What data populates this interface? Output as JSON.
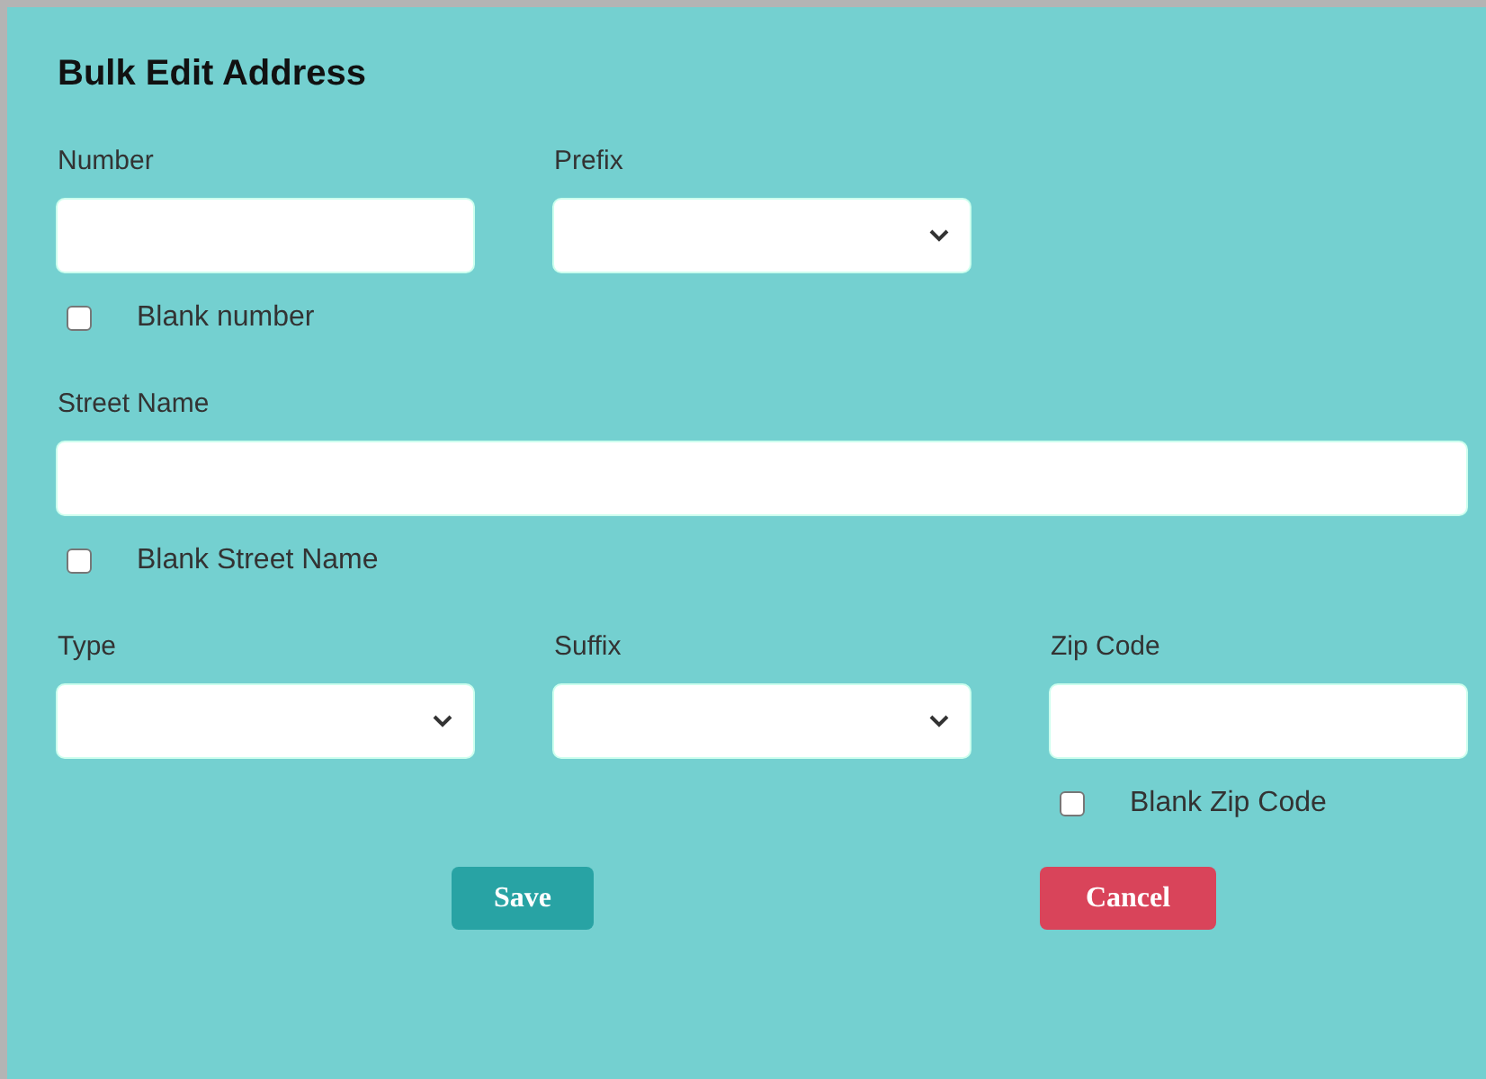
{
  "title": "Bulk Edit Address",
  "rows": [
    {
      "fields": [
        {
          "kind": "text",
          "label": "Number",
          "blank_option": {
            "label": "Blank number",
            "checked": false
          }
        },
        {
          "kind": "select",
          "label": "Prefix"
        }
      ]
    },
    {
      "fields": [
        {
          "kind": "wide-text",
          "label": "Street Name",
          "blank_option": {
            "label": "Blank Street Name",
            "checked": false
          }
        }
      ]
    },
    {
      "fields": [
        {
          "kind": "select",
          "label": "Type"
        },
        {
          "kind": "select",
          "label": "Suffix"
        },
        {
          "kind": "text",
          "label": "Zip Code",
          "blank_option": {
            "label": "Blank Zip Code",
            "checked": false
          }
        }
      ]
    }
  ],
  "buttons": [
    {
      "label": "Save",
      "kind": "primary"
    },
    {
      "label": "Cancel",
      "kind": "danger"
    }
  ]
}
